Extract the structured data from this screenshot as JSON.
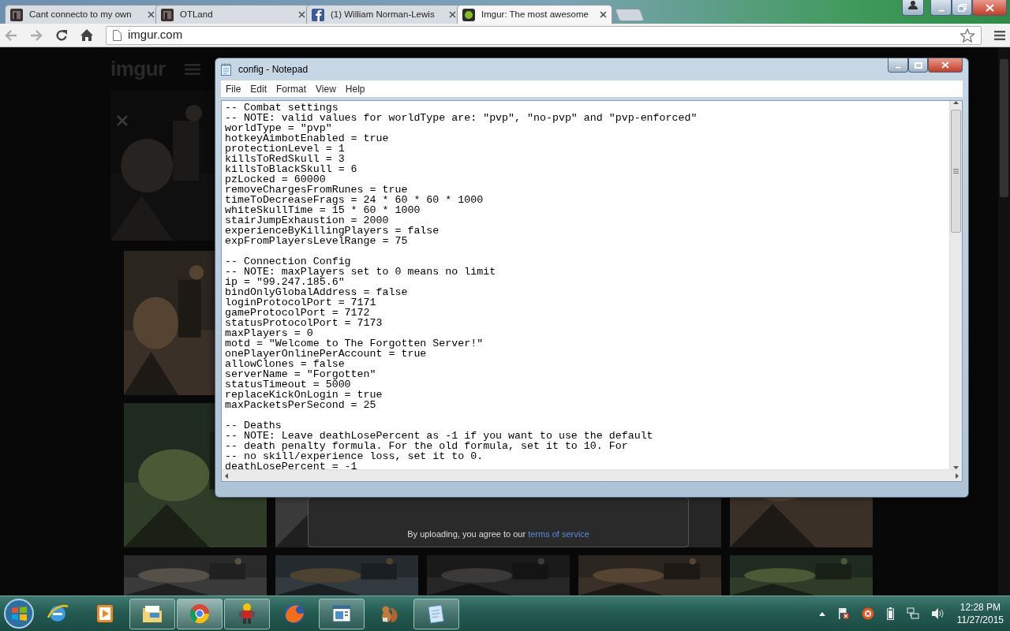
{
  "browser": {
    "tabs": [
      {
        "title": "Cant connecto to my own",
        "kind": "dark-logo",
        "selected": false
      },
      {
        "title": "OTLand",
        "kind": "dark-logo",
        "selected": false
      },
      {
        "title": "(1) William Norman-Lewis",
        "kind": "f-logo",
        "selected": false
      },
      {
        "title": "Imgur: The most awesome",
        "kind": "dot-logo",
        "selected": true
      }
    ],
    "address": "imgur.com"
  },
  "page": {
    "logo": "imgur",
    "upload_notice": {
      "text": "By uploading, you agree to our",
      "link": "terms of service"
    }
  },
  "notepad": {
    "title": "config - Notepad",
    "menu": [
      "File",
      "Edit",
      "Format",
      "View",
      "Help"
    ],
    "blocks": [
      [
        "-- Combat settings",
        "-- NOTE: valid values for worldType are: \"pvp\", \"no-pvp\" and \"pvp-enforced\"",
        "worldType = \"pvp\"",
        "hotkeyAimbotEnabled = true",
        "protectionLevel = 1",
        "killsToRedSkull = 3",
        "killsToBlackSkull = 6",
        "pzLocked = 60000",
        "removeChargesFromRunes = true",
        "timeToDecreaseFrags = 24 * 60 * 60 * 1000",
        "whiteSkullTime = 15 * 60 * 1000",
        "stairJumpExhaustion = 2000",
        "experienceByKillingPlayers = false",
        "expFromPlayersLevelRange = 75"
      ],
      [
        "-- Connection Config",
        "-- NOTE: maxPlayers set to 0 means no limit",
        "ip = \"99.247.185.6\"",
        "bindOnlyGlobalAddress = false",
        "loginProtocolPort = 7171",
        "gameProtocolPort = 7172",
        "statusProtocolPort = 7173",
        "maxPlayers = 0",
        "motd = \"Welcome to The Forgotten Server!\"",
        "onePlayerOnlinePerAccount = true",
        "allowClones = false",
        "serverName = \"Forgotten\"",
        "statusTimeout = 5000",
        "replaceKickOnLogin = true",
        "maxPacketsPerSecond = 25"
      ],
      [
        "-- Deaths",
        "-- NOTE: Leave deathLosePercent as -1 if you want to use the default",
        "-- death penalty formula. For the old formula, set it to 10. For",
        "-- no skill/experience loss, set it to 0.",
        "deathLosePercent = -1"
      ]
    ]
  },
  "taskbar": {
    "apps": [
      {
        "kind": "e-globe",
        "running": false,
        "selected": false
      },
      {
        "kind": "play",
        "running": false,
        "selected": false
      },
      {
        "kind": "folder",
        "running": true,
        "selected": false
      },
      {
        "kind": "round-logo",
        "running": true,
        "selected": true
      },
      {
        "kind": "figure",
        "running": true,
        "selected": false
      },
      {
        "kind": "fox-globe",
        "running": false,
        "selected": false
      },
      {
        "kind": "window",
        "running": true,
        "selected": false
      },
      {
        "kind": "squirrel",
        "running": false,
        "selected": false
      },
      {
        "kind": "notepad",
        "running": true,
        "selected": false
      }
    ],
    "clock": {
      "time": "12:28 PM",
      "date": "11/27/2015"
    }
  }
}
